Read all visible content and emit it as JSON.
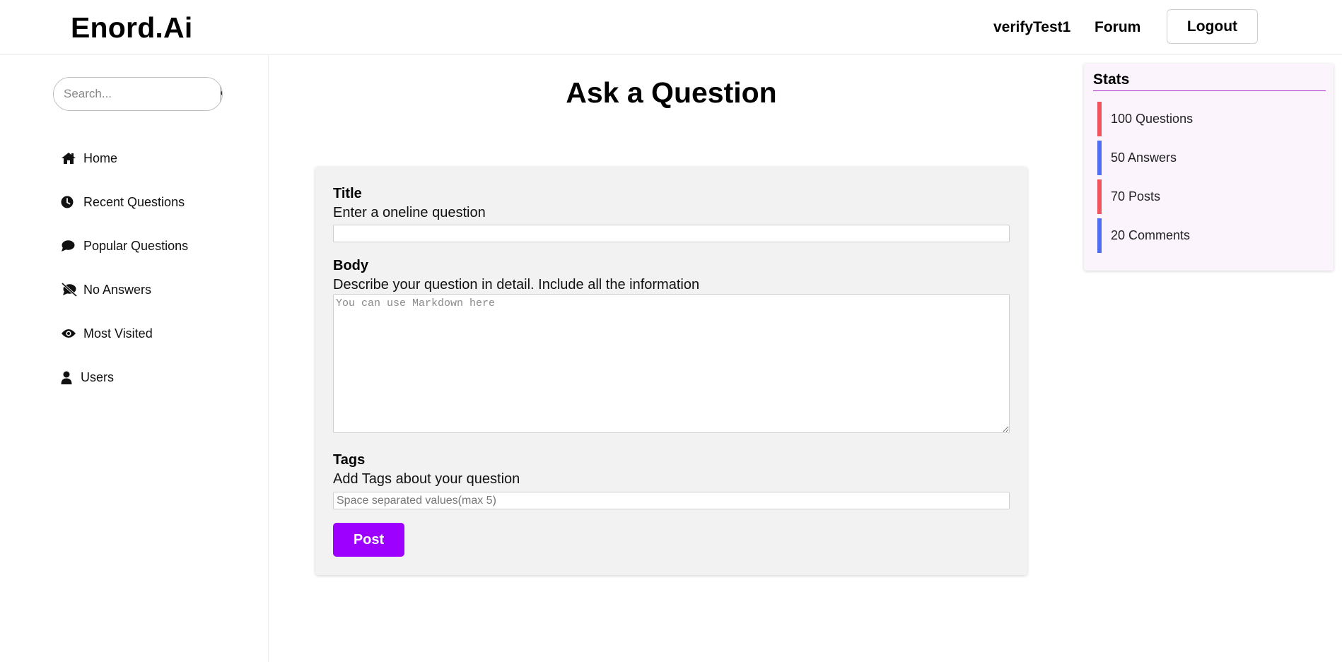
{
  "header": {
    "brand": "Enord.Ai",
    "username": "verifyTest1",
    "forum_label": "Forum",
    "logout_label": "Logout"
  },
  "sidebar": {
    "search_placeholder": "Search...",
    "items": [
      {
        "label": "Home",
        "icon": "home-icon"
      },
      {
        "label": "Recent Questions",
        "icon": "clock-icon"
      },
      {
        "label": "Popular Questions",
        "icon": "comment-icon"
      },
      {
        "label": "No Answers",
        "icon": "comment-slash-icon"
      },
      {
        "label": "Most Visited",
        "icon": "eye-icon"
      },
      {
        "label": "Users",
        "icon": "user-icon"
      }
    ]
  },
  "main": {
    "title": "Ask a Question",
    "form": {
      "title_label": "Title",
      "title_desc": "Enter a oneline question",
      "title_value": "",
      "body_label": "Body",
      "body_desc": "Describe your question in detail. Include all the information",
      "body_placeholder": "You can use Markdown here",
      "tags_label": "Tags",
      "tags_desc": "Add Tags about your question",
      "tags_placeholder": "Space separated values(max 5)",
      "post_label": "Post"
    }
  },
  "stats": {
    "title": "Stats",
    "items": [
      {
        "text": "100 Questions",
        "color": "#f0545f"
      },
      {
        "text": "50 Answers",
        "color": "#4f6df0"
      },
      {
        "text": "70 Posts",
        "color": "#f0545f"
      },
      {
        "text": "20 Comments",
        "color": "#4f6df0"
      }
    ]
  },
  "colors": {
    "accent": "#9d00ff",
    "stats_bg": "#fbf4fd",
    "stats_underline": "#b03ad0"
  }
}
